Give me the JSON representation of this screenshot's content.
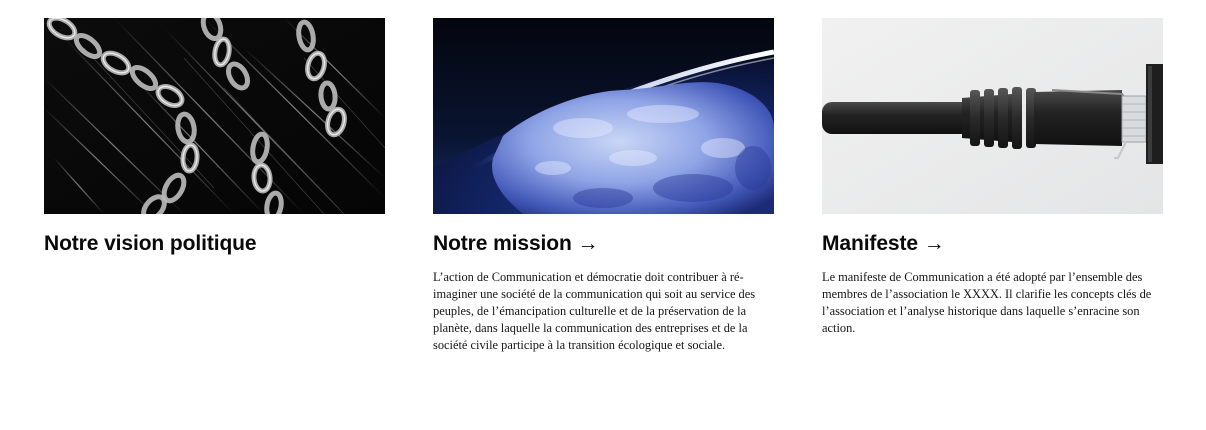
{
  "cards": [
    {
      "title": "Notre vision politique",
      "image_icon": "chains-image",
      "text": ""
    },
    {
      "title": "Notre mission →",
      "image_icon": "ice-planet-image",
      "text": "L’action de Communication et démocratie doit contribuer à ré-imaginer une société de la communication qui soit au service des peuples, de l’émancipation culturelle et de la préservation de la planète, dans laquelle la communication des entreprises et de la société civile participe à la transition écologique et sociale."
    },
    {
      "title": "Manifeste →",
      "image_icon": "network-cable-image",
      "text": "Le manifeste de Communication a été adopté par l’ensemble des membres de  l’association le XXXX. Il clarifie les concepts clés de l’association et l’analyse historique dans laquelle s’enracine son action."
    }
  ]
}
